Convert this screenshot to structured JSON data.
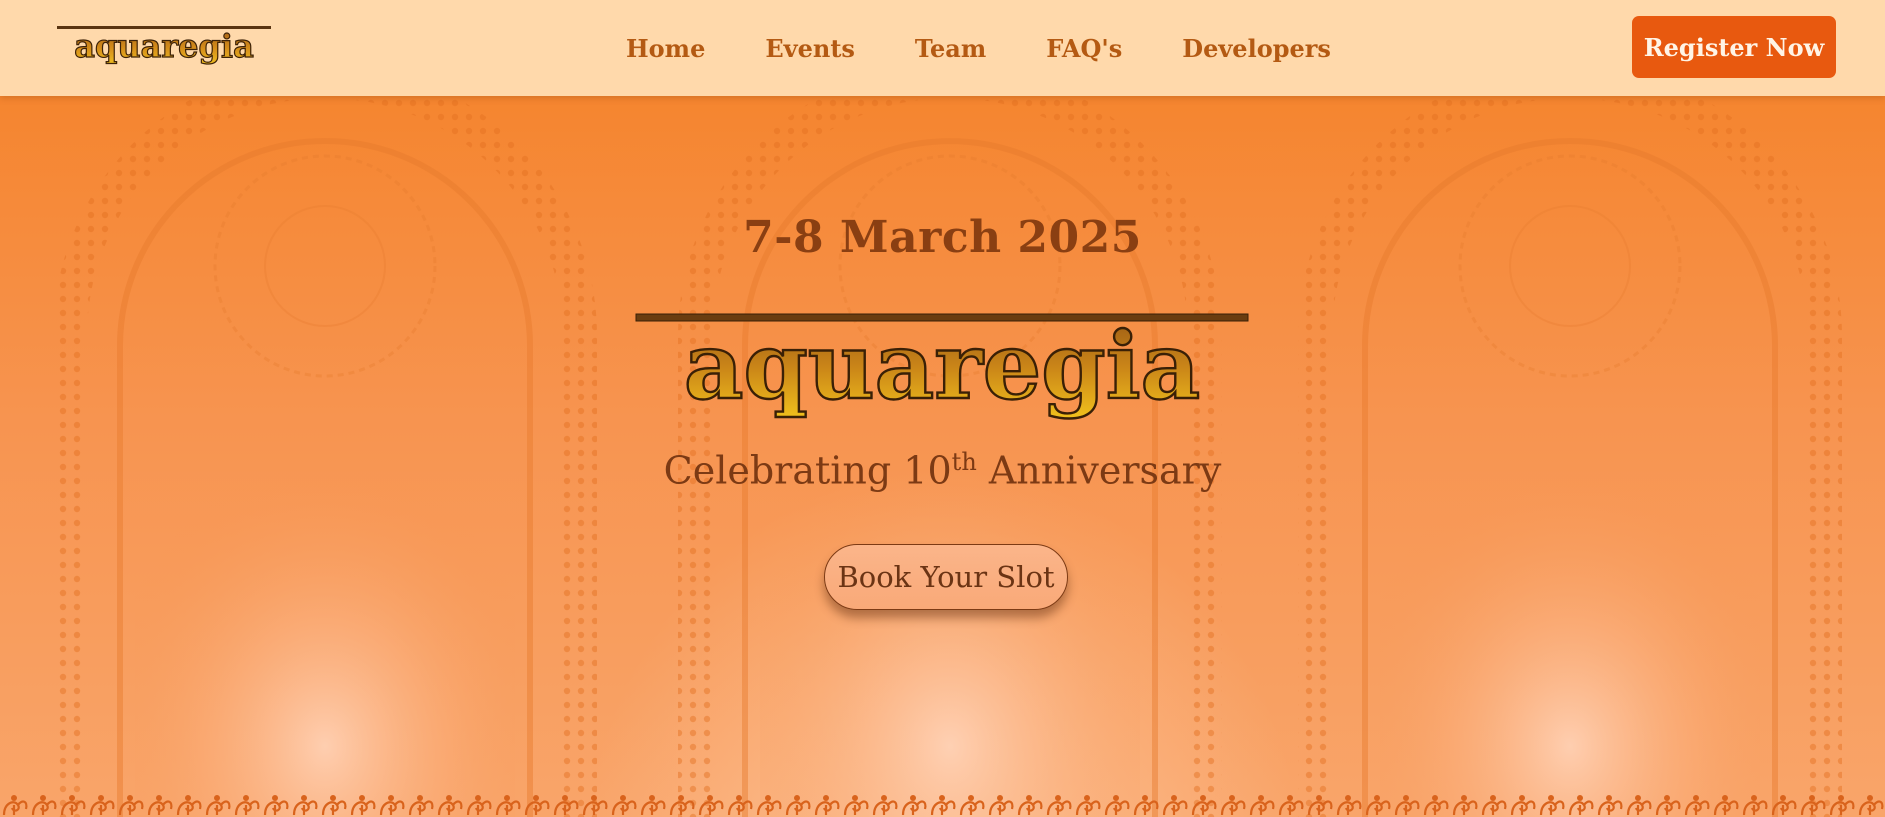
{
  "brand": {
    "name": "aquaregia"
  },
  "nav": {
    "links": [
      "Home",
      "Events",
      "Team",
      "FAQ's",
      "Developers"
    ],
    "register_label": "Register Now"
  },
  "hero": {
    "date": "7-8 March 2025",
    "celebrating_prefix": "Celebrating 10",
    "celebrating_sup": "th",
    "celebrating_suffix": " Anniversary",
    "cta_label": "Book Your Slot"
  },
  "colors": {
    "nav_bg": "#ffd9ab",
    "accent": "#e8590f",
    "hero_orange": "#f5873a",
    "text_brown": "#8a3f12"
  },
  "icons": [
    "aquaregia-logo",
    "flask-icon",
    "arch-ornament",
    "floral-border"
  ]
}
